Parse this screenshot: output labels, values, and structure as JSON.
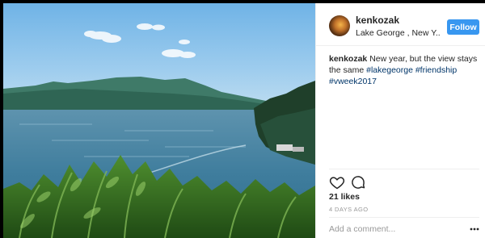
{
  "post": {
    "username": "kenkozak",
    "location": "Lake George , New Y...",
    "follow_label": "Follow",
    "caption_username": "kenkozak",
    "caption_text": "New year, but the view stays the same",
    "hashtags": [
      "#lakegeorge",
      "#friendship",
      "#vweek2017"
    ],
    "likes": "21 likes",
    "time_ago": "4 DAYS AGO",
    "comment_placeholder": "Add a comment..."
  },
  "icons": {
    "avatar": "avatar",
    "like": "heart-icon",
    "comment": "comment-icon",
    "more": "more-options-icon"
  },
  "colors": {
    "follow_button": "#3897f0",
    "hashtag": "#003569",
    "muted_text": "#999999",
    "text": "#262626"
  }
}
